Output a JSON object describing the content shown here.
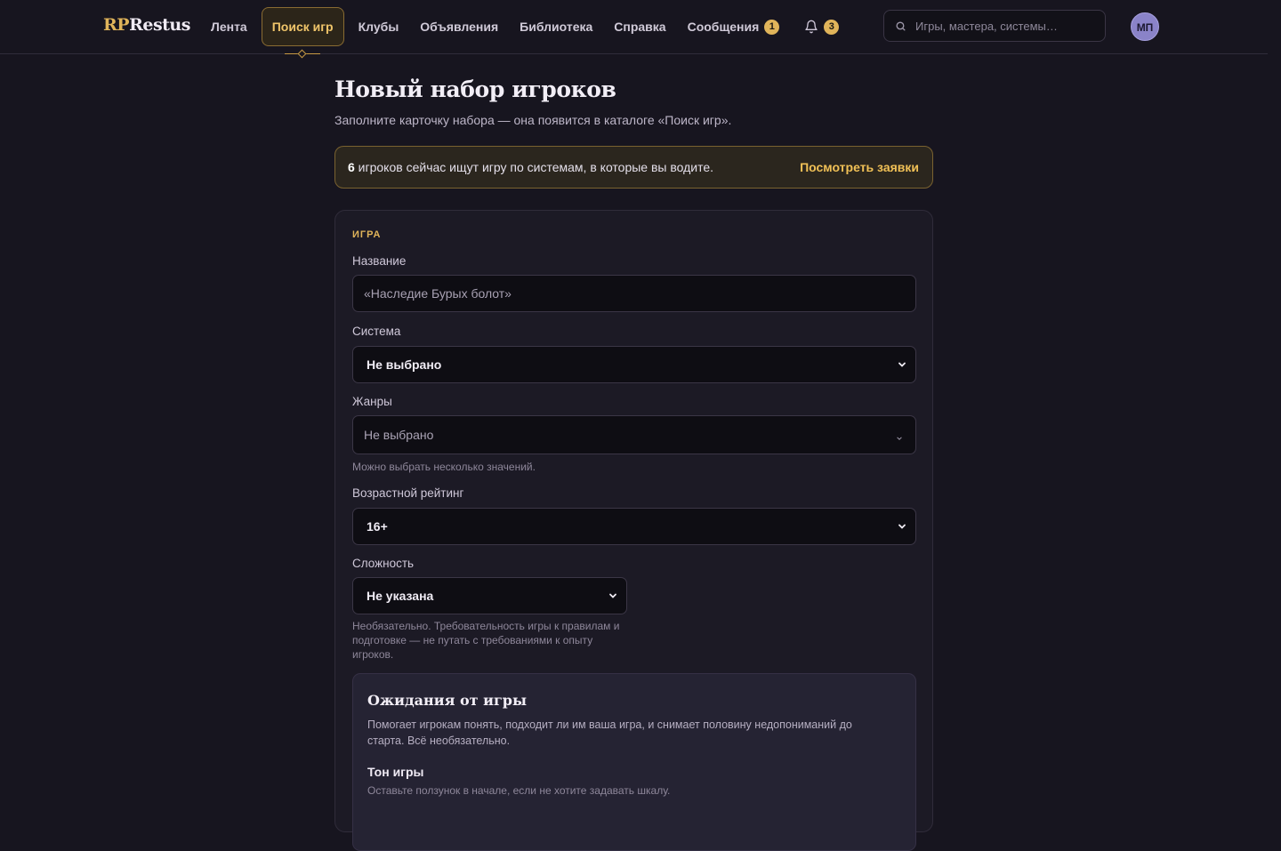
{
  "header": {
    "logo_rp": "RP",
    "logo_rest": "Restus",
    "nav": [
      {
        "label": "Лента"
      },
      {
        "label": "Поиск игр"
      },
      {
        "label": "Клубы"
      },
      {
        "label": "Объявления"
      },
      {
        "label": "Библиотека"
      },
      {
        "label": "Справка"
      },
      {
        "label": "Сообщения",
        "badge": "1"
      }
    ],
    "notifications_badge": "3",
    "search_placeholder": "Игры, мастера, системы…",
    "avatar_initials": "МП"
  },
  "page": {
    "title": "Новый набор игроков",
    "subtitle": "Заполните карточку набора — она появится в каталоге «Поиск игр».",
    "notice": {
      "count": "6",
      "text": " игроков сейчас ищут игру по системам, в которые вы водите.",
      "link": "Посмотреть заявки"
    }
  },
  "form": {
    "section": "ИГРА",
    "name_label": "Название",
    "name_placeholder": "«Наследие Бурых болот»",
    "system_label": "Система",
    "system_value": "Не выбрано",
    "genres_label": "Жанры",
    "genres_value": "Не выбрано",
    "genres_hint": "Можно выбрать несколько значений.",
    "age_label": "Возрастной рейтинг",
    "age_value": "16+",
    "complexity_label": "Сложность",
    "complexity_value": "Не указана",
    "complexity_hint": "Необязательно. Требовательность игры к правилам и подготовке — не путать с требованиями к опыту игроков.",
    "expectations": {
      "title": "Ожидания от игры",
      "desc": "Помогает игрокам понять, подходит ли им ваша игра, и снимает половину недопониманий до старта. Всё необязательно.",
      "tone_label": "Тон игры",
      "tone_hint": "Оставьте ползунок в начале, если не хотите задавать шкалу."
    }
  },
  "colors": {
    "accent": "#e0b45a",
    "background": "#17151f",
    "card": "#1c1a25"
  }
}
